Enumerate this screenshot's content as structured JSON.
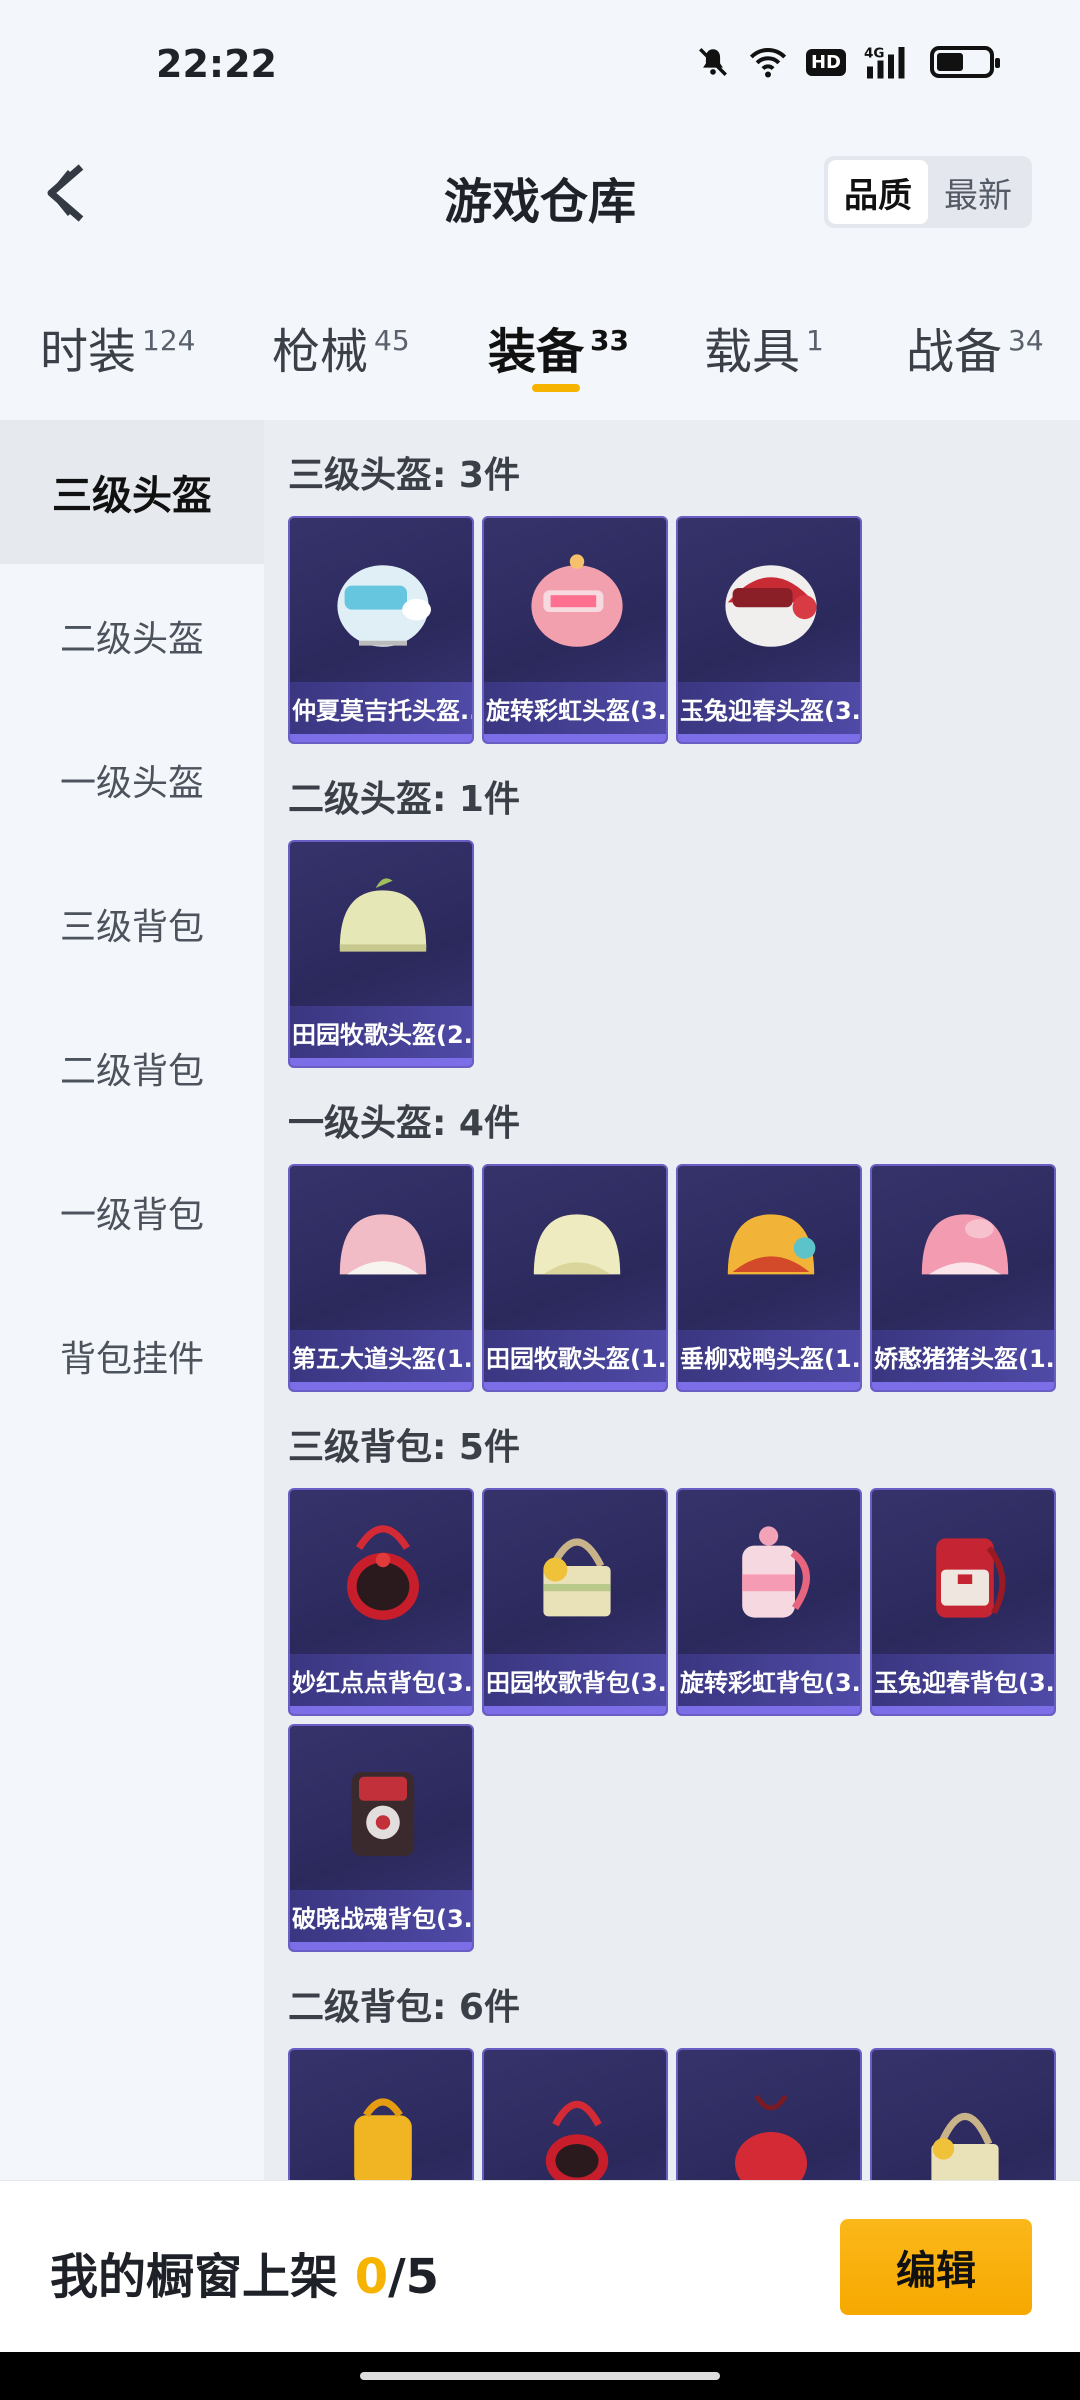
{
  "status": {
    "time": "22:22",
    "hd": "HD",
    "signal_label": "4G"
  },
  "header": {
    "title": "游戏仓库",
    "sort": [
      "品质",
      "最新"
    ]
  },
  "tabs": [
    {
      "label": "时装",
      "count": "124"
    },
    {
      "label": "枪械",
      "count": "45"
    },
    {
      "label": "装备",
      "count": "33"
    },
    {
      "label": "载具",
      "count": "1"
    },
    {
      "label": "战备",
      "count": "34"
    }
  ],
  "sidebar": [
    "三级头盔",
    "二级头盔",
    "一级头盔",
    "三级背包",
    "二级背包",
    "一级背包",
    "背包挂件"
  ],
  "sections": [
    {
      "title": "三级头盔: 3件",
      "items": [
        "仲夏莫吉托头盔...",
        "旋转彩虹头盔(3...",
        "玉兔迎春头盔(3..."
      ]
    },
    {
      "title": "二级头盔: 1件",
      "items": [
        "田园牧歌头盔(2..."
      ]
    },
    {
      "title": "一级头盔: 4件",
      "items": [
        "第五大道头盔(1...",
        "田园牧歌头盔(1...",
        "垂柳戏鸭头盔(1...",
        "娇憨猪猪头盔(1..."
      ]
    },
    {
      "title": "三级背包: 5件",
      "items": [
        "妙红点点背包(3...",
        "田园牧歌背包(3...",
        "旋转彩虹背包(3...",
        "玉兔迎春背包(3...",
        "破晓战魂背包(3..."
      ]
    },
    {
      "title": "二级背包: 6件",
      "items": [
        "",
        "",
        "",
        ""
      ]
    }
  ],
  "bottom": {
    "shelf_label": "我的橱窗上架 ",
    "shelf_count": "0",
    "shelf_total": "/5",
    "edit": "编辑"
  },
  "colors": {
    "accent": "#f6b300",
    "card_bg": "#2f2d63",
    "card_border": "#6a5ec4"
  }
}
